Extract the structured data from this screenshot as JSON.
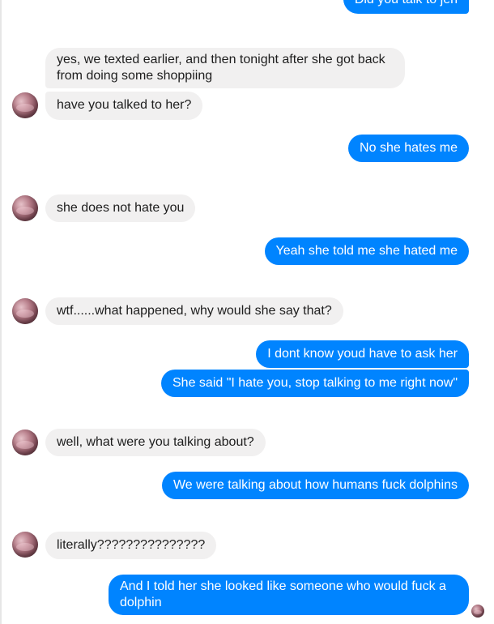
{
  "messages": {
    "m0": "Did you talk to jen",
    "m1": "yes, we texted earlier, and then tonight after she got back from doing some shoppiing",
    "m2": "have you talked to her?",
    "m3": "No she hates me",
    "m4": "she does not hate you",
    "m5": "Yeah she told me she hated me",
    "m6": "wtf......what happened, why would she say that?",
    "m7": "I dont know youd have to ask her",
    "m8": "She said \"I hate you, stop talking to me right now\"",
    "m9": "well, what were you talking about?",
    "m10": "We were talking about how humans fuck dolphins",
    "m11": "literally???????????????",
    "m12": "And I told her she looked like someone who would fuck a dolphin"
  },
  "colors": {
    "outgoing_bubble": "#0084ff",
    "incoming_bubble": "#f1f0f0",
    "outgoing_text": "#ffffff",
    "incoming_text": "#1d1d1d"
  },
  "icons": {
    "contact_avatar": "contact-avatar",
    "read_receipt_avatar": "read-receipt-avatar"
  }
}
